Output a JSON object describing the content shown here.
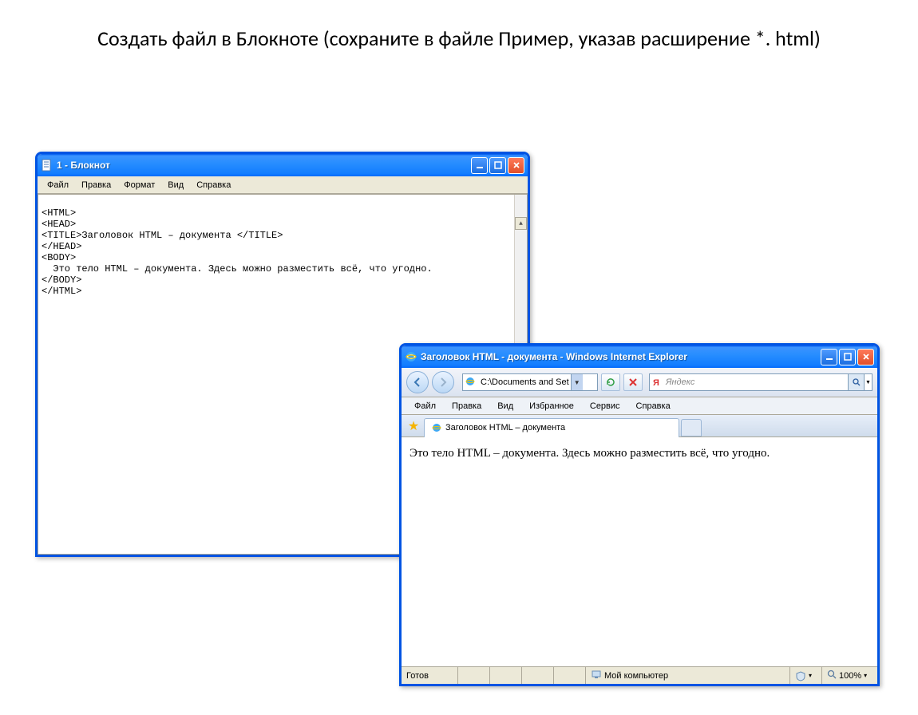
{
  "heading": "Создать файл в Блокноте (сохраните в файле  Пример,  указав расширение  *. html)",
  "notepad": {
    "title": "1 - Блокнот",
    "menus": [
      "Файл",
      "Правка",
      "Формат",
      "Вид",
      "Справка"
    ],
    "lines": [
      "<HTML>",
      "<HEAD>",
      "<TITLE>Заголовок HTML – документа </TITLE>",
      "</HEAD>",
      "<BODY>",
      "  Это тело HTML – документа. Здесь можно разместить всё, что угодно.",
      "</BODY>",
      "</HTML>"
    ]
  },
  "ie": {
    "title": "Заголовок HTML - документа - Windows Internet Explorer",
    "address": "C:\\Documents and Set",
    "search_placeholder": "Яндекс",
    "menus": [
      "Файл",
      "Правка",
      "Вид",
      "Избранное",
      "Сервис",
      "Справка"
    ],
    "tab_label": "Заголовок HTML – документа",
    "body_text": "Это тело HTML – документа. Здесь можно разместить всё, что угодно.",
    "status_left": "Готов",
    "status_zone": "Мой компьютер",
    "zoom": "100%"
  }
}
